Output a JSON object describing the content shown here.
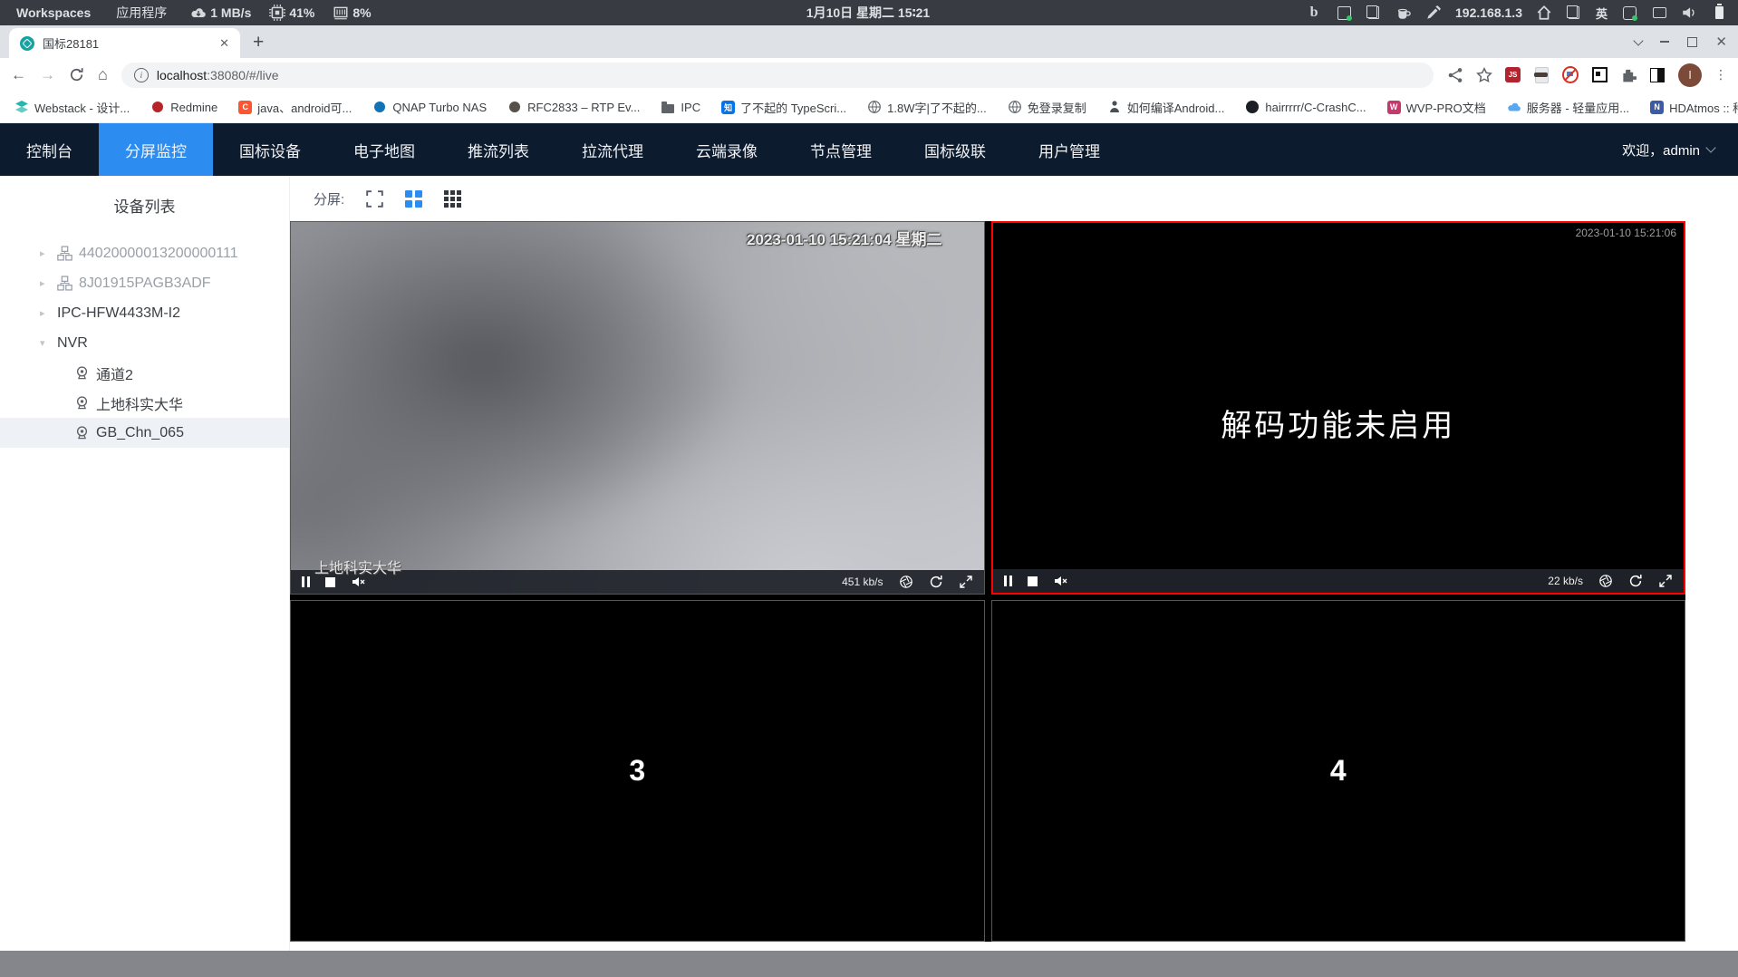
{
  "desktop_bar": {
    "workspaces": "Workspaces",
    "applications": "应用程序",
    "net_speed": "1 MB/s",
    "cpu_usage": "41%",
    "mem_usage": "8%",
    "clock": "1月10日 星期二 15∶21",
    "bing_glyph": "b",
    "ip_address": "192.168.1.3",
    "input_method": "英"
  },
  "browser": {
    "tab_title": "国标28181",
    "url_host": "localhost",
    "url_rest": ":38080/#/live",
    "js_badge": "JS",
    "avatar_letter": "I",
    "bookmarks": [
      "Webstack - 设计...",
      "Redmine",
      "java、android可...",
      "QNAP Turbo NAS",
      "RFC2833 – RTP Ev...",
      "IPC",
      "了不起的 TypeScri...",
      "1.8W字|了不起的...",
      "免登录复制",
      "如何编译Android...",
      "hairrrrr/C-CrashC...",
      "WVP-PRO文档",
      "服务器 - 轻量应用...",
      "HDAtmos :: 种子 *...",
      "»"
    ],
    "glyphs": {
      "csdn": "C",
      "zhihu": "知",
      "wvp": "W",
      "hdatmos": "N"
    }
  },
  "app": {
    "nav_items": [
      "控制台",
      "分屏监控",
      "国标设备",
      "电子地图",
      "推流列表",
      "拉流代理",
      "云端录像",
      "节点管理",
      "国标级联",
      "用户管理"
    ],
    "welcome": "欢迎，admin",
    "sidebar": {
      "title": "设备列表",
      "tree": [
        {
          "label": "44020000013200000111"
        },
        {
          "label": "8J01915PAGB3ADF"
        },
        {
          "label": "IPC-HFW4433M-I2"
        },
        {
          "label": "NVR"
        },
        {
          "label": "通道2"
        },
        {
          "label": "上地科实大华"
        },
        {
          "label": "GB_Chn_065"
        }
      ]
    },
    "toolbar": {
      "split_label": "分屏:"
    },
    "players": {
      "p1": {
        "osd_timestamp": "2023-01-10 15:21:04 星期二",
        "osd_label": "上地科实大华",
        "bitrate": "451 kb/s"
      },
      "p2": {
        "osd_timestamp": "2023-01-10 15:21:06",
        "message": "解码功能未启用",
        "bitrate": "22 kb/s"
      },
      "p3": {
        "number": "3"
      },
      "p4": {
        "number": "4"
      }
    }
  }
}
